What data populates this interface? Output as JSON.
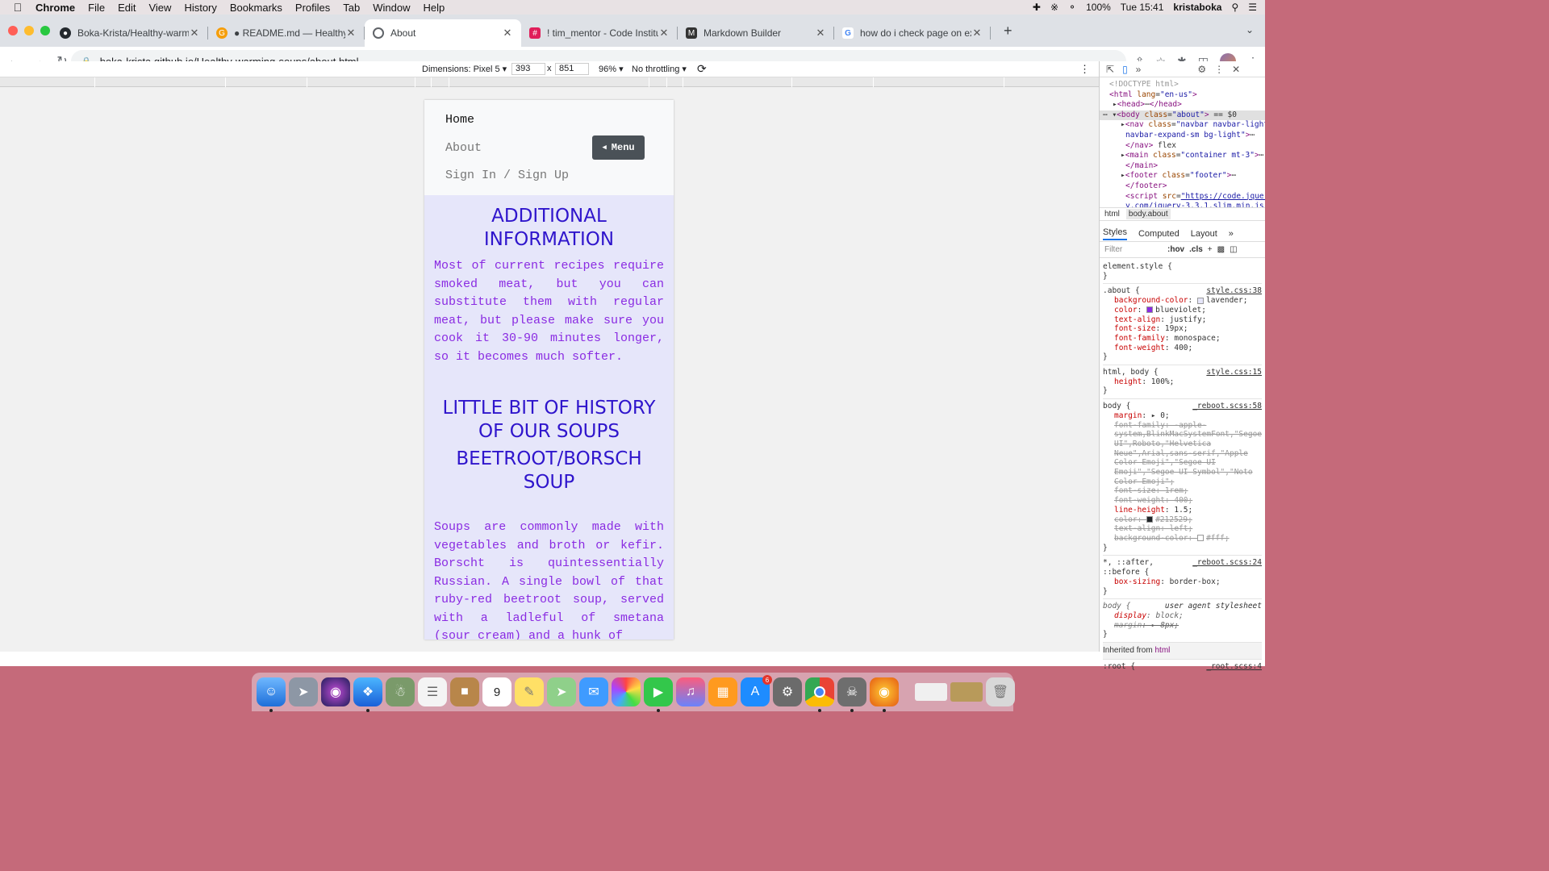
{
  "menubar": {
    "app": "Chrome",
    "items": [
      "File",
      "Edit",
      "View",
      "History",
      "Bookmarks",
      "Profiles",
      "Tab",
      "Window",
      "Help"
    ],
    "battery": "100%",
    "clock": "Tue 15:41",
    "user": "kristaboka"
  },
  "browser": {
    "tabs": [
      {
        "label": "Boka-Krista/Healthy-warming-",
        "icon": "github-icon",
        "color": "#24292e"
      },
      {
        "label": "● README.md — Healthy-war",
        "icon": "gitpod-icon",
        "color": "#f59e0b"
      },
      {
        "label": "About",
        "icon": "globe-icon",
        "color": "#5f6368"
      },
      {
        "label": "! tim_mentor - Code Institute -",
        "icon": "slack-icon",
        "color": "#e01e5a"
      },
      {
        "label": "Markdown Builder",
        "icon": "markdown-icon",
        "color": "#333333"
      },
      {
        "label": "how do i check page on excel o",
        "icon": "google-icon",
        "color": "#4285f4"
      }
    ],
    "url": "boka-krista.github.io/Healthy-warming-soups/about.html"
  },
  "device_toolbar": {
    "dimensions": "Dimensions: Pixel 5 ▾",
    "width": "393",
    "height": "851",
    "x": "x",
    "zoom": "96% ▾",
    "throttling": "No throttling ▾"
  },
  "site": {
    "nav": {
      "home": "Home",
      "about": "About",
      "signin": "Sign In / Sign Up",
      "menu": "Menu"
    },
    "heading1": "ADDITIONAL INFORMATION",
    "para1": "Most of current recipes require smoked meat, but you can substitute them with regular meat, but please make sure you cook it 30-90 minutes longer, so it becomes much softer.",
    "heading2": "LITTLE BIT OF HISTORY OF OUR SOUPS",
    "heading3": "BEETROOT/BORSCH SOUP",
    "para2": "Soups are commonly made with vegetables and broth or kefir. Borscht is quintessentially Russian. A single bowl of that ruby-red beetroot soup, served with a ladleful of smetana (sour cream) and a hunk of",
    "bg_color": "#e6e6fa",
    "text_color": "#8a2be2"
  },
  "devtools": {
    "crumbs": [
      "html",
      "body.about"
    ],
    "tabs": [
      "Styles",
      "Computed",
      "Layout"
    ],
    "filter_placeholder": "Filter",
    "hov": ":hov",
    "cls": ".cls",
    "inherited": "Inherited from",
    "inherited_from": "html",
    "root": ":root {",
    "root_src": "_root.scss:4"
  }
}
